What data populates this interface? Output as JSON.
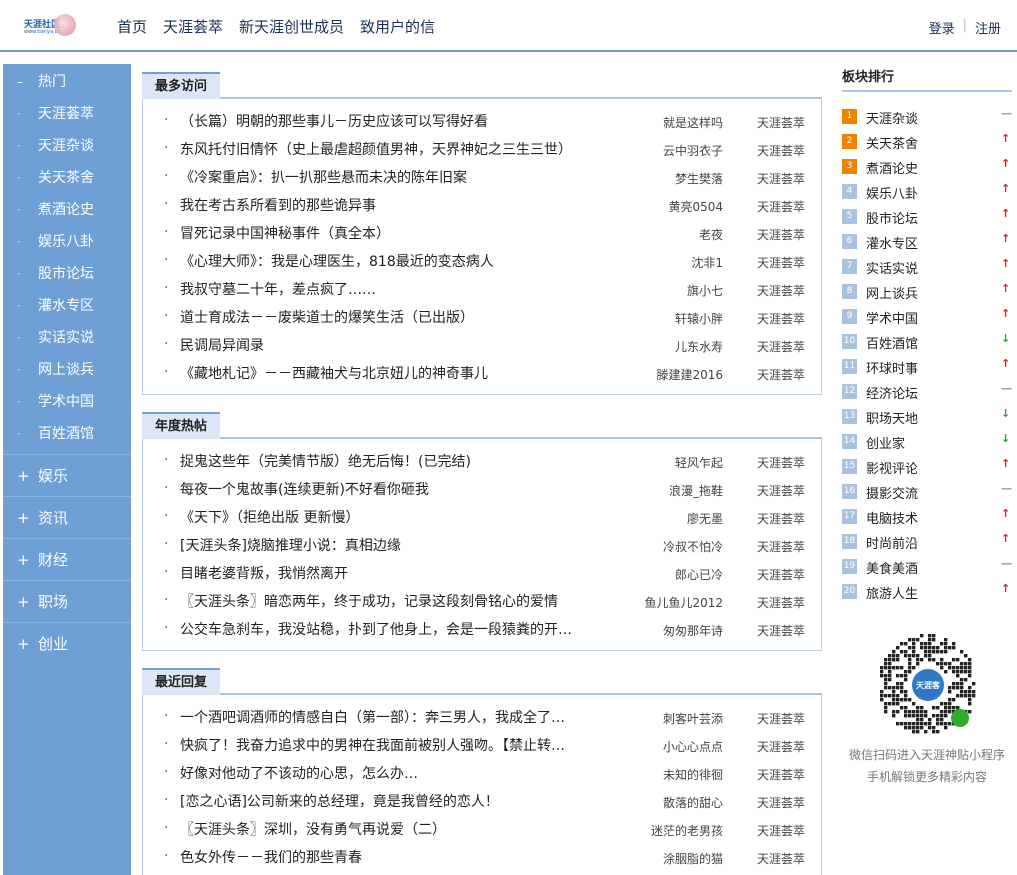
{
  "header": {
    "logo_text": "天涯社区",
    "logo_sub": "www.tianya.cn",
    "nav": [
      "首页",
      "天涯荟萃",
      "新天涯创世成员",
      "致用户的信"
    ],
    "login": "登录",
    "register": "注册"
  },
  "sidebar": {
    "hot_label": "热门",
    "hot_bullet": "–",
    "items": [
      "天涯荟萃",
      "天涯杂谈",
      "关天茶舍",
      "煮酒论史",
      "娱乐八卦",
      "股市论坛",
      "灌水专区",
      "实话实说",
      "网上谈兵",
      "学术中国",
      "百姓酒馆"
    ],
    "categories": [
      "娱乐",
      "资讯",
      "财经",
      "职场",
      "创业"
    ]
  },
  "sections": [
    {
      "title": "最多访问",
      "rows": [
        {
          "title": "（长篇）明朝的那些事儿－历史应该可以写得好看",
          "author": "就是这样吗",
          "board": "天涯荟萃"
        },
        {
          "title": "东风托付旧情怀（史上最虐超颜值男神，天界神妃之三生三世）",
          "author": "云中羽衣子",
          "board": "天涯荟萃"
        },
        {
          "title": "《冷案重启》：扒一扒那些悬而未决的陈年旧案",
          "author": "梦生樊落",
          "board": "天涯荟萃"
        },
        {
          "title": "我在考古系所看到的那些诡异事",
          "author": "黄亮0504",
          "board": "天涯荟萃"
        },
        {
          "title": "冒死记录中国神秘事件（真全本）",
          "author": "老夜",
          "board": "天涯荟萃"
        },
        {
          "title": "《心理大师》：我是心理医生，818最近的变态病人",
          "author": "沈非1",
          "board": "天涯荟萃"
        },
        {
          "title": "我叔守墓二十年，差点疯了……",
          "author": "旗小七",
          "board": "天涯荟萃"
        },
        {
          "title": "道士育成法－－废柴道士的爆笑生活（已出版）",
          "author": "轩辕小胖",
          "board": "天涯荟萃"
        },
        {
          "title": "民调局异闻录",
          "author": "儿东水寿",
          "board": "天涯荟萃"
        },
        {
          "title": "《藏地札记》－－西藏袖犬与北京妞儿的神奇事儿",
          "author": "滕建建2016",
          "board": "天涯荟萃"
        }
      ]
    },
    {
      "title": "年度热帖",
      "rows": [
        {
          "title": "捉鬼这些年（完美情节版）绝无后悔！(已完结)",
          "author": "轻风乍起",
          "board": "天涯荟萃"
        },
        {
          "title": "每夜一个鬼故事(连续更新)不好看你砸我",
          "author": "浪漫_拖鞋",
          "board": "天涯荟萃"
        },
        {
          "title": "《天下》（拒绝出版 更新慢）",
          "author": "廖无墨",
          "board": "天涯荟萃"
        },
        {
          "title": "[天涯头条]烧脑推理小说：真相边缘",
          "author": "冷叔不怕冷",
          "board": "天涯荟萃"
        },
        {
          "title": "目睹老婆背叛，我悄然离开",
          "author": "郎心已冷",
          "board": "天涯荟萃"
        },
        {
          "title": "〖天涯头条〗暗恋两年，终于成功，记录这段刻骨铭心的爱情",
          "author": "鱼儿鱼儿2012",
          "board": "天涯荟萃"
        },
        {
          "title": "公交车急刹车，我没站稳，扑到了他身上，会是一段猿粪的开…",
          "author": "匆匆那年诗",
          "board": "天涯荟萃"
        }
      ]
    },
    {
      "title": "最近回复",
      "rows": [
        {
          "title": "一个酒吧调酒师的情感自白（第一部）：奔三男人，我成全了…",
          "author": "刺客叶芸添",
          "board": "天涯荟萃"
        },
        {
          "title": "快疯了！我奋力追求中的男神在我面前被别人强吻。【禁止转…",
          "author": "小心心点点",
          "board": "天涯荟萃"
        },
        {
          "title": "好像对他动了不该动的心思，怎么办…",
          "author": "未知的徘徊",
          "board": "天涯荟萃"
        },
        {
          "title": "[恋之心语]公司新来的总经理，竟是我曾经的恋人！",
          "author": "散落的甜心",
          "board": "天涯荟萃"
        },
        {
          "title": "〖天涯头条〗深圳，没有勇气再说爱（二）",
          "author": "迷茫的老男孩",
          "board": "天涯荟萃"
        },
        {
          "title": "色女外传－－我们的那些青春",
          "author": "涂胭脂的猫",
          "board": "天涯荟萃"
        }
      ]
    }
  ],
  "rank": {
    "title": "板块排行",
    "items": [
      {
        "num": "1",
        "name": "天涯杂谈",
        "trend": "flat"
      },
      {
        "num": "2",
        "name": "关天茶舍",
        "trend": "up"
      },
      {
        "num": "3",
        "name": "煮酒论史",
        "trend": "up"
      },
      {
        "num": "4",
        "name": "娱乐八卦",
        "trend": "up"
      },
      {
        "num": "5",
        "name": "股市论坛",
        "trend": "up"
      },
      {
        "num": "6",
        "name": "灌水专区",
        "trend": "up"
      },
      {
        "num": "7",
        "name": "实话实说",
        "trend": "up"
      },
      {
        "num": "8",
        "name": "网上谈兵",
        "trend": "up"
      },
      {
        "num": "9",
        "name": "学术中国",
        "trend": "up"
      },
      {
        "num": "10",
        "name": "百姓酒馆",
        "trend": "down"
      },
      {
        "num": "11",
        "name": "环球时事",
        "trend": "up"
      },
      {
        "num": "12",
        "name": "经济论坛",
        "trend": "flat"
      },
      {
        "num": "13",
        "name": "职场天地",
        "trend": "down"
      },
      {
        "num": "14",
        "name": "创业家",
        "trend": "down"
      },
      {
        "num": "15",
        "name": "影视评论",
        "trend": "up"
      },
      {
        "num": "16",
        "name": "摄影交流",
        "trend": "flat"
      },
      {
        "num": "17",
        "name": "电脑技术",
        "trend": "up"
      },
      {
        "num": "18",
        "name": "时尚前沿",
        "trend": "up"
      },
      {
        "num": "19",
        "name": "美食美酒",
        "trend": "flat"
      },
      {
        "num": "20",
        "name": "旅游人生",
        "trend": "up"
      }
    ],
    "qr_badge": "天涯客",
    "qr_caption_1": "微信扫码进入天涯神贴小程序",
    "qr_caption_2": "手机解锁更多精彩内容"
  },
  "colors": {
    "header_rule": "#6b9ad3",
    "sidebar_bg": "#6e9fd5",
    "tab_bg": "#dbe7f6",
    "rank_hot": "#f08300",
    "rank_normal": "#a9c2e0",
    "trend_up": "#e02020",
    "trend_down": "#2a9d2a"
  }
}
